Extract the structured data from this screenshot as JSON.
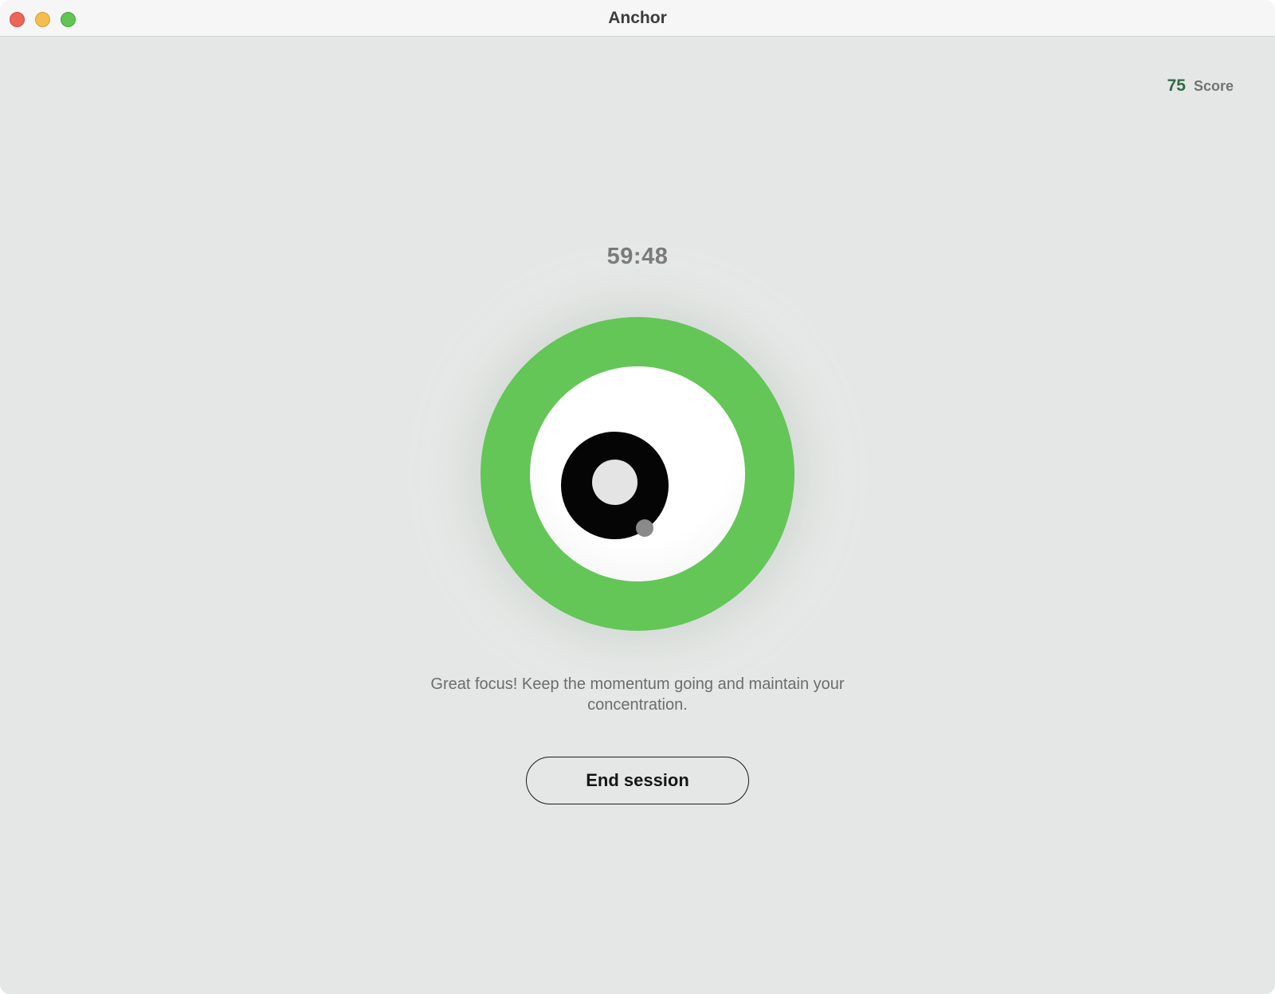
{
  "window": {
    "title": "Anchor"
  },
  "score": {
    "value": "75",
    "label": "Score"
  },
  "session": {
    "timer": "59:48",
    "message": "Great focus! Keep the momentum going and maintain your concentration.",
    "end_button_label": "End session"
  },
  "colors": {
    "focus_ring": "#63c657",
    "score_value": "#2f6b45",
    "background": "#e4e7e5"
  },
  "icons": {
    "close": "close-window-icon",
    "minimize": "minimize-window-icon",
    "maximize": "maximize-window-icon",
    "focus_indicator": "eye-icon"
  }
}
